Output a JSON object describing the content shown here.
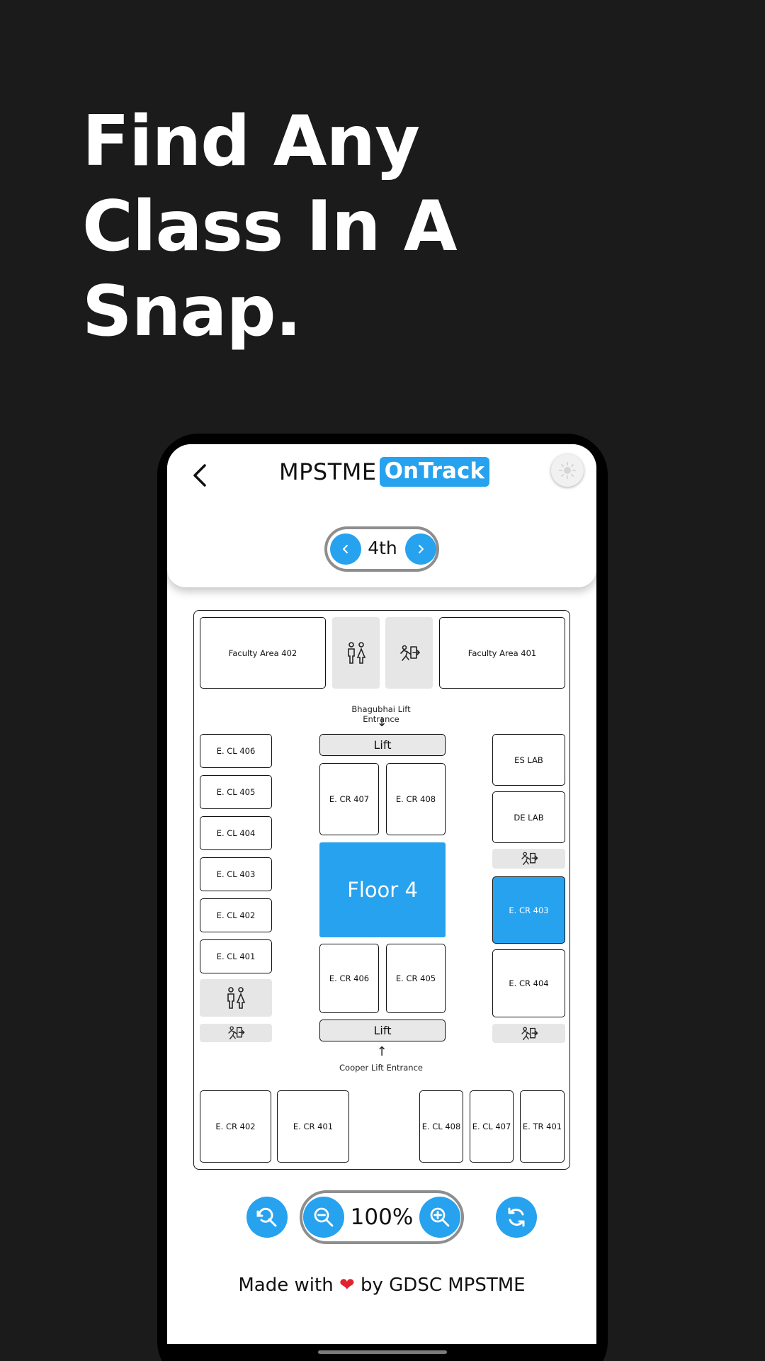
{
  "headline": {
    "line1": "Find Any",
    "line2": "Class In A",
    "line3": "Snap."
  },
  "app": {
    "logo_part1": "MPSTME",
    "logo_part2": "OnTrack",
    "accent_color": "#27a2ee"
  },
  "floor_selector": {
    "current": "4th"
  },
  "map": {
    "faculty_left": "Faculty Area 402",
    "faculty_right": "Faculty Area 401",
    "top_entrance": "Bhagubhai Lift Entrance",
    "bottom_entrance": "Cooper Lift Entrance",
    "lift_label": "Lift",
    "floor_label": "Floor 4",
    "left_column": [
      "E. CL 406",
      "E. CL 405",
      "E. CL 404",
      "E. CL 403",
      "E. CL 402",
      "E. CL 401"
    ],
    "center_top": [
      "E. CR 407",
      "E. CR 408"
    ],
    "center_bottom": [
      "E. CR 406",
      "E. CR 405"
    ],
    "right_column": [
      "ES LAB",
      "DE LAB",
      "E. CR 403",
      "E. CR 404"
    ],
    "bottom_row": [
      "E. CR 402",
      "E. CR 401",
      "E. CL 408",
      "E. CL 407",
      "E. TR 401"
    ],
    "icons": [
      "restroom-icon",
      "emergency-exit-icon"
    ]
  },
  "zoom": {
    "level": "100%"
  },
  "footer": {
    "prefix": "Made with",
    "heart": "❤",
    "suffix": "by GDSC MPSTME"
  }
}
